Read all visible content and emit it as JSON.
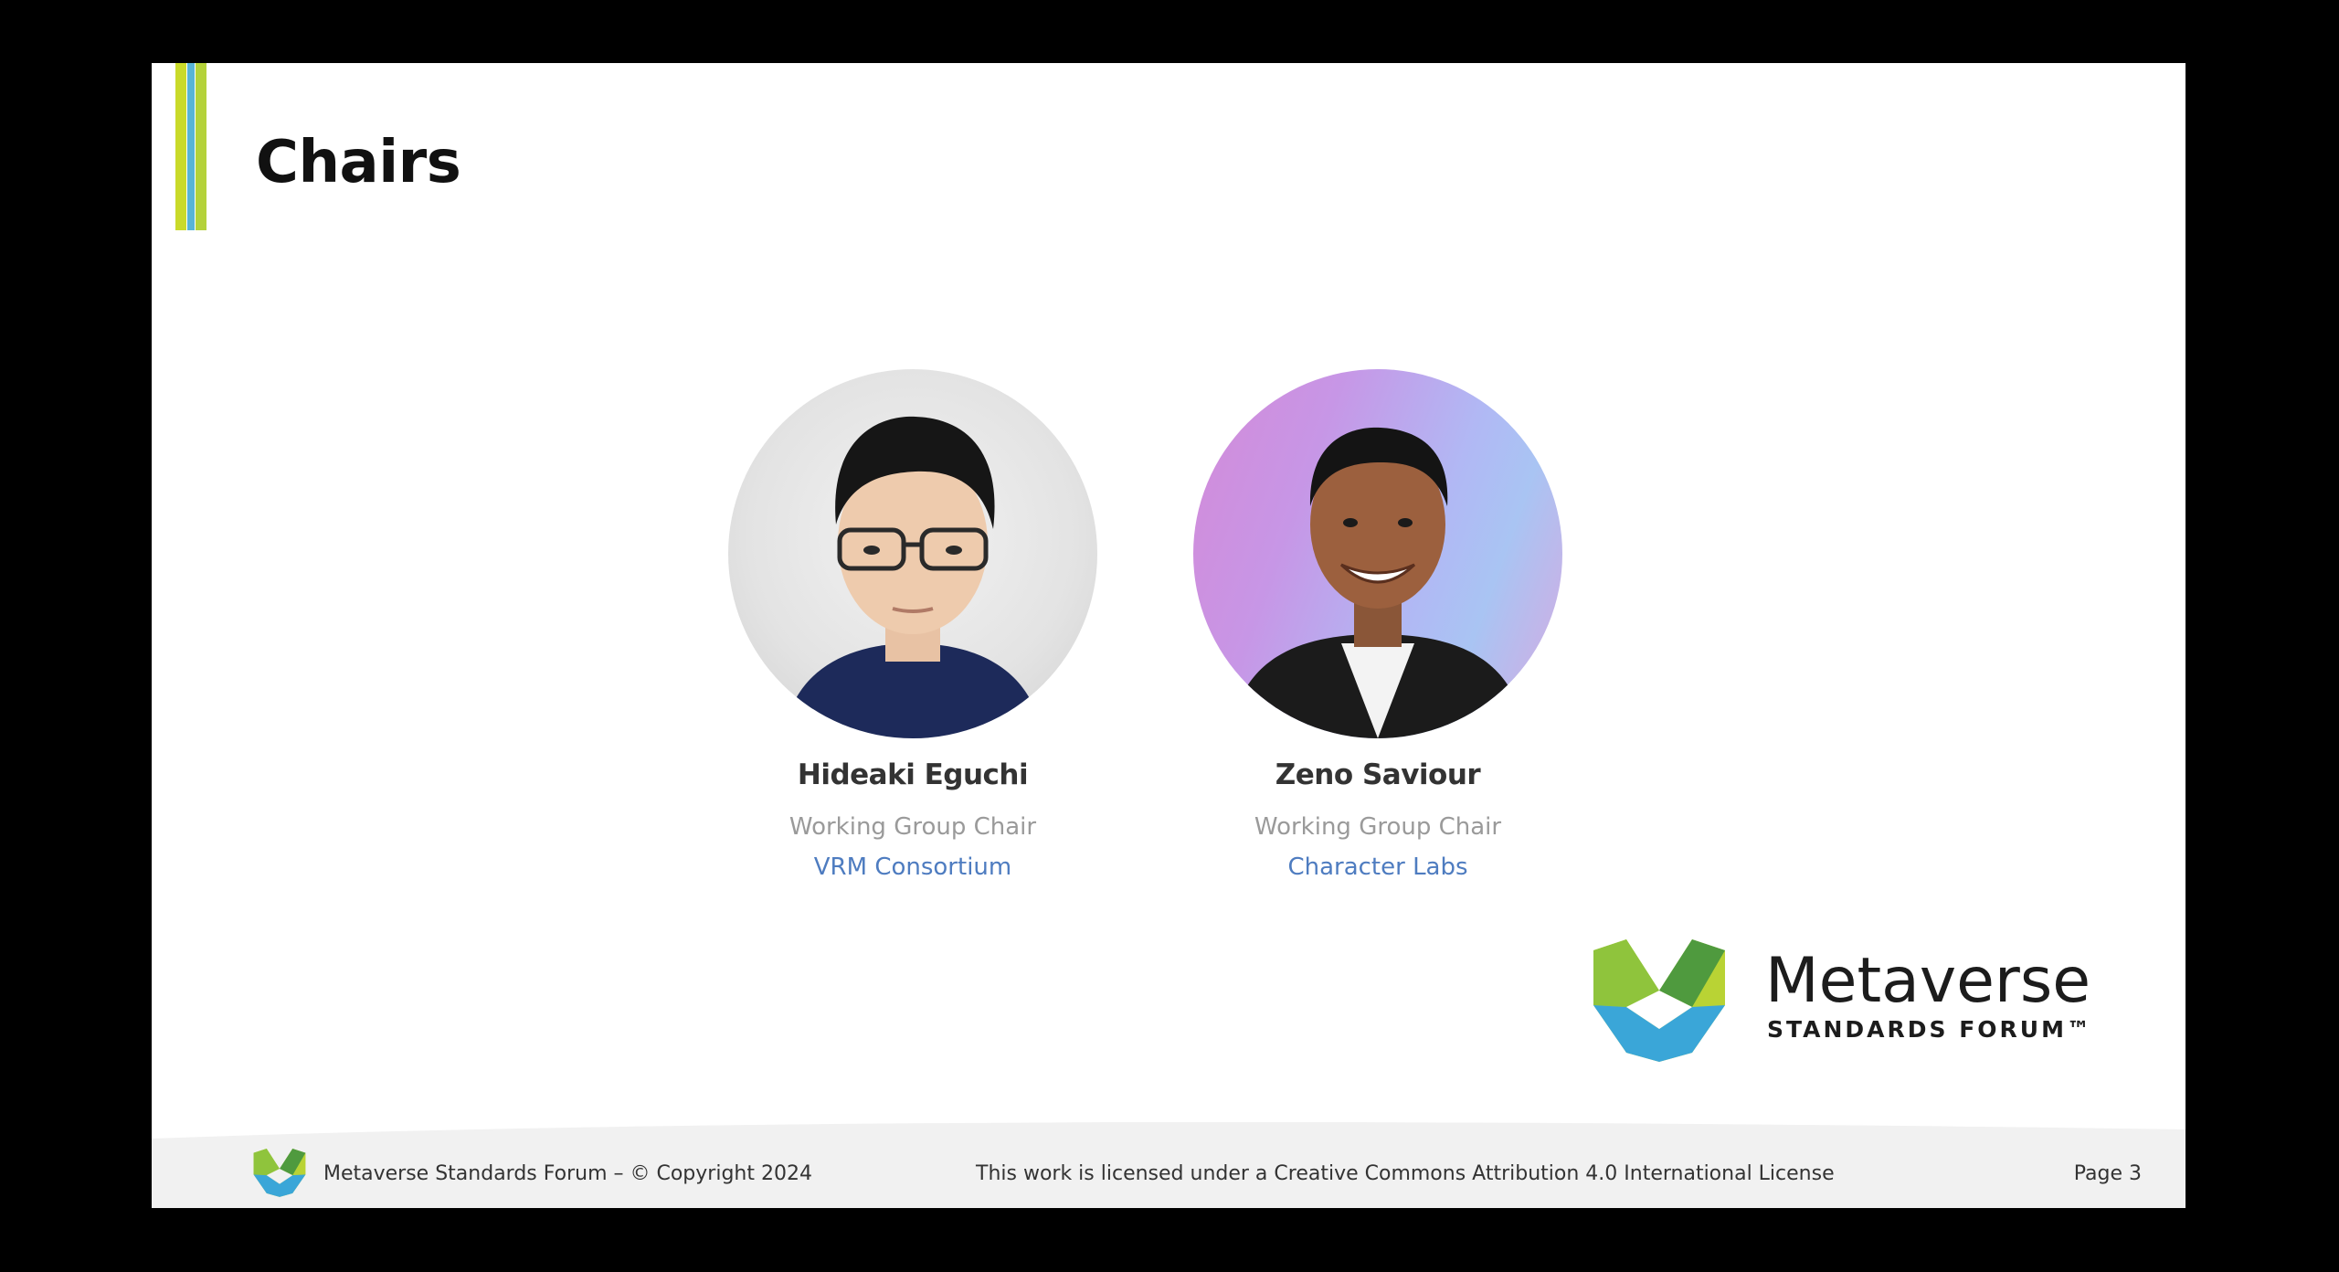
{
  "slide": {
    "title": "Chairs"
  },
  "chairs": [
    {
      "name": "Hideaki Eguchi",
      "role": "Working Group Chair",
      "organization": "VRM Consortium"
    },
    {
      "name": "Zeno Saviour",
      "role": "Working Group Chair",
      "organization": "Character Labs"
    }
  ],
  "brand": {
    "wordmark": "Metaverse",
    "subline": "STANDARDS FORUM™"
  },
  "footer": {
    "copyright": "Metaverse Standards Forum – © Copyright 2024",
    "license": "This work is licensed under a Creative Commons Attribution 4.0 International License",
    "page": "Page 3"
  },
  "icons": {
    "logo": "metaverse-forum-logo-icon"
  },
  "colors": {
    "accent_green": "#c9da2a",
    "accent_blue": "#58b4d6",
    "link_blue": "#4e7cc0",
    "role_gray": "#9a9a9a"
  }
}
